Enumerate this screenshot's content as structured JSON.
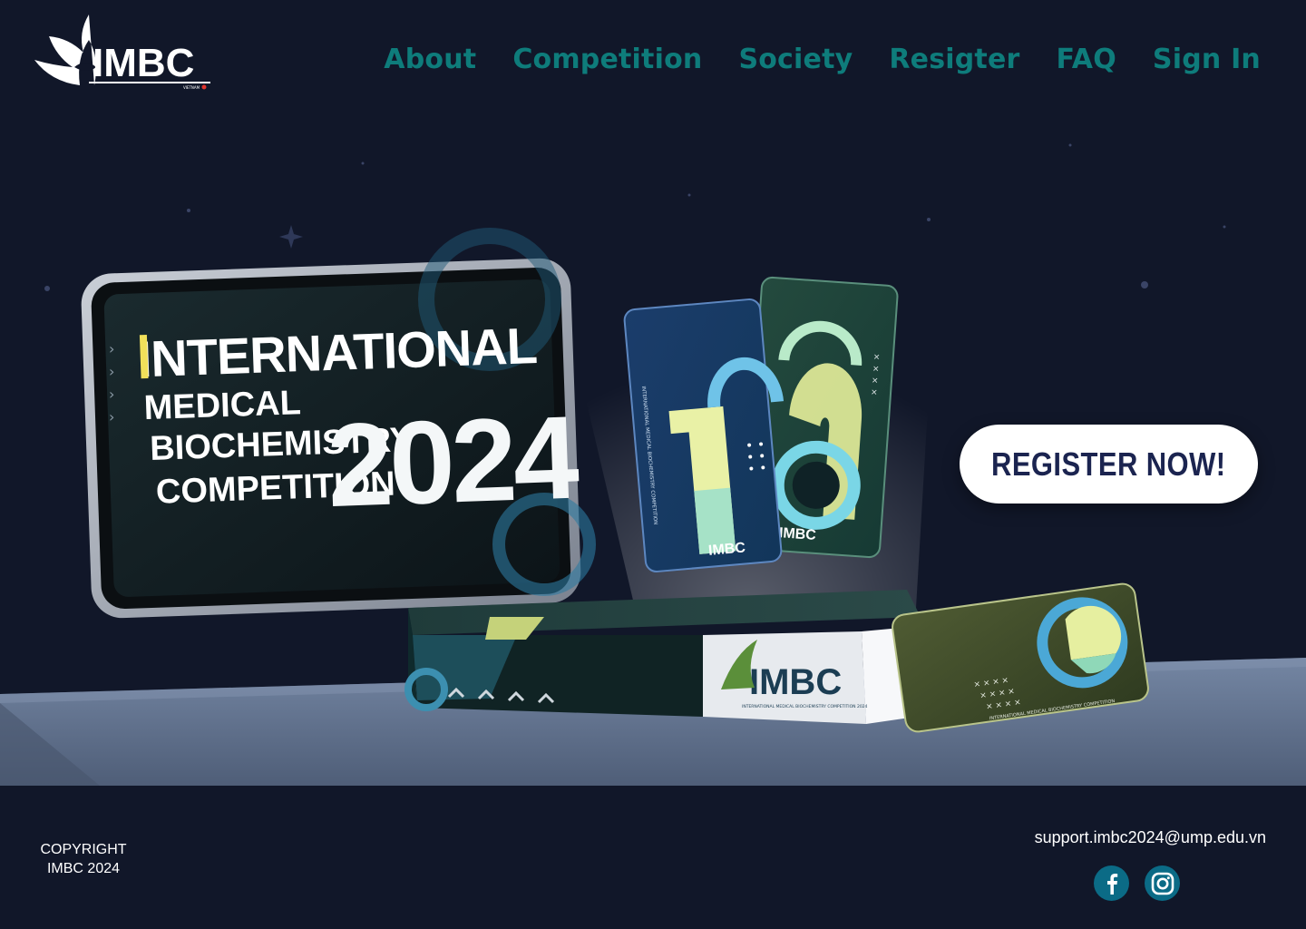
{
  "brand": {
    "logo_text": "IMBC",
    "logo_subtext": "VIETNAM"
  },
  "nav": {
    "items": [
      {
        "label": "About"
      },
      {
        "label": "Competition"
      },
      {
        "label": "Society"
      },
      {
        "label": "Resigter"
      },
      {
        "label": "FAQ"
      },
      {
        "label": "Sign In"
      }
    ]
  },
  "hero": {
    "tablet_title": {
      "line1": "INTERNATIONAL",
      "line2": "MEDICAL",
      "line3": "BIOCHEMISTRY",
      "line4": "COMPETITION",
      "year": "2024"
    },
    "card_text": "INTERNATIONAL MEDICAL BIOCHEMISTRY COMPETITION",
    "card_logo": "IMBC",
    "box_logo": "IMBC",
    "box_subtext": "INTERNATIONAL MEDICAL BIOCHEMISTRY COMPETITION 2024",
    "register_label": "REGISTER NOW!"
  },
  "footer": {
    "copyright_line1": "COPYRIGHT",
    "copyright_line2": "IMBC 2024",
    "email": "support.imbc2024@ump.edu.vn",
    "social": [
      {
        "icon": "facebook-icon"
      },
      {
        "icon": "instagram-icon"
      }
    ]
  },
  "colors": {
    "background": "#111729",
    "nav_text": "#0e7c7b",
    "register_text": "#1b2450",
    "social_bg": "#0b6b86",
    "floor": "#5f6f8c"
  }
}
